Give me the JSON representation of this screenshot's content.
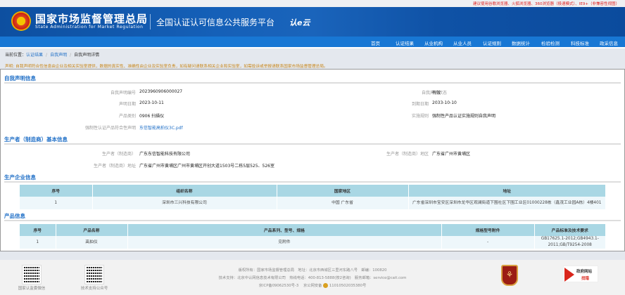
{
  "topbar": {
    "browser_tip": "建议使用谷歌浏览器、火狐浏览器、360浏览器（极速模式）、IE9+（非兼容性视图）"
  },
  "header": {
    "title_cn": "国家市场监督管理总局",
    "title_en": "State Administration  for  Market Regulation",
    "platform": "全国认证认可信息公共服务平台",
    "brand": "认e云"
  },
  "nav": [
    "首页",
    "认证结果",
    "从业机构",
    "从业人员",
    "认证规则",
    "数据统计",
    "检验检测",
    "科技标准",
    "政采信息"
  ],
  "breadcrumb": {
    "prefix": "当前位置：",
    "items": [
      "认证结果",
      "自我声明",
      "自我声明详情"
    ]
  },
  "notice": "声明: 自我声明符合性信息由企业及相关实验室提供，数据的真实性、准确性由企业及实验室负责，如有疑问请联系相关企业和实验室，如需投诉或举报请联系国家市场监督管理总局。",
  "declaration": {
    "heading": "自我声明信息",
    "fields": [
      {
        "label": "自我声明编号",
        "value": "2023960906000027"
      },
      {
        "label": "自我声明状态",
        "value": "有效"
      },
      {
        "label": "声明日期",
        "value": "2023-10-11"
      },
      {
        "label": "到期日期",
        "value": "2033-10-10"
      },
      {
        "label": "产品类别",
        "value": "0906 扫描仪"
      },
      {
        "label": "实施规则",
        "value": "强制性产品认证实施规则自我声明"
      },
      {
        "label": "强制性认证产品符合性声明",
        "value": "东信智能高拍仪3C.pdf"
      }
    ]
  },
  "producer": {
    "heading": "生产者（制造商）基本信息",
    "fields": [
      {
        "label": "生产者（制造商）",
        "value": "广东东信智能科技有限公司"
      },
      {
        "label": "生产者（制造商）地区",
        "value": "广东省广州市黄埔区"
      },
      {
        "label": "生产者（制造商）地址",
        "value": "广东省广州市黄埔区广州市黄埔区开创大道1503号二栋5层525、526室"
      }
    ]
  },
  "factory": {
    "heading": "生产企业信息",
    "columns": [
      "序号",
      "组织名称",
      "国家地区",
      "地址"
    ],
    "rows": [
      [
        "1",
        "深圳市三兴科技有限公司",
        "中国 广东省",
        "广东省深圳市宝安区深圳市龙华区观澜街道下围社区下围工业区01000228栋（鑫茂工业园A栋）4楼401"
      ]
    ]
  },
  "product": {
    "heading": "产品信息",
    "columns": [
      "序号",
      "产品名称",
      "产品系列、型号、规格",
      "规格型号附件",
      "产品标准及技术要求"
    ],
    "rows": [
      [
        "1",
        "高拍仪",
        "见附件",
        "-",
        "GB17625.1-2012;GB4943.1-2011;GB/T9254-2008"
      ]
    ]
  },
  "footer": {
    "qr1": "国家认监委微信",
    "qr2": "技术支持公众号",
    "line1": "版权所有：国家市场监督管理总局　地址：北京市西城区三里河东路八号　邮编：100820",
    "line2": "技术支持：北京中认网信息技术有限公司　热线电话：400-813-5888(按2咨询)　服务邮箱：service@cait.com",
    "icp": "京ICP备09062530号-3",
    "police": "京公网安备",
    "police_no": "11010502035380号",
    "gov_t1": "政府网站",
    "gov_t2": "找错"
  }
}
